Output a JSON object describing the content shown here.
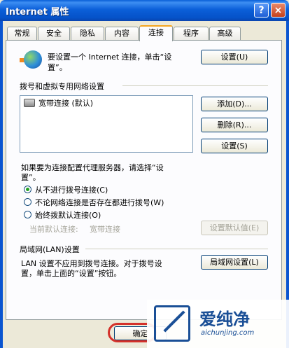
{
  "window": {
    "title": "Internet 属性",
    "help_label": "?",
    "close_label": "×"
  },
  "tabs": [
    "常规",
    "安全",
    "隐私",
    "内容",
    "连接",
    "程序",
    "高级"
  ],
  "active_tab": "连接",
  "setup": {
    "text_line1": "要设置一个 Internet 连接，单击“设",
    "text_line2": "置”。",
    "button": "设置(U)"
  },
  "dialup": {
    "group_label": "拨号和虚拟专用网络设置",
    "list_items": [
      "宽带连接 (默认)"
    ],
    "add_button": "添加(D)...",
    "remove_button": "删除(R)...",
    "settings_button": "设置(S)",
    "proxy_text_line1": "如果要为连接配置代理服务器，请选择“设",
    "proxy_text_line2": "置”。",
    "radio_options": [
      "从不进行拨号连接(C)",
      "不论网络连接是否存在都进行拨号(W)",
      "始终拨默认连接(O)"
    ],
    "selected_option": "从不进行拨号连接(C)",
    "current_default_label": "当前默认连接:",
    "current_default_value": "宽带连接",
    "set_default_button": "设置默认值(E)"
  },
  "lan": {
    "group_label": "局域网(LAN)设置",
    "text_line1": "LAN 设置不应用到拨号连接。对于拨号设",
    "text_line2": "置，单击上面的“设置”按钮。",
    "button": "局域网设置(L)"
  },
  "footer": {
    "ok_button": "确定"
  },
  "watermark": {
    "brand": "爱纯净",
    "url": "aichunjing.com"
  },
  "colors": {
    "titlebar": "#0a5fd8",
    "highlight_ring": "#d4312a",
    "selected_radio": "#21a121"
  }
}
